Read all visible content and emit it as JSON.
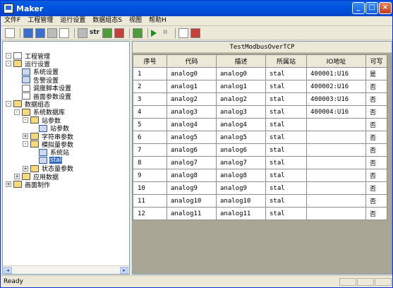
{
  "app": {
    "title": "Maker"
  },
  "menu": [
    "文件F",
    "工程管理",
    "运行设置",
    "数据组态S",
    "视图",
    "帮助H"
  ],
  "toolbar": {
    "str_label": "str"
  },
  "tree": [
    {
      "label": "工程管理",
      "level": 1,
      "expander": "-",
      "icon": "doc",
      "selected": false
    },
    {
      "label": "运行设置",
      "level": 1,
      "expander": "-",
      "icon": "folder",
      "selected": false
    },
    {
      "label": "系统设置",
      "level": 2,
      "expander": "",
      "icon": "win",
      "selected": false
    },
    {
      "label": "告警设置",
      "level": 2,
      "expander": "",
      "icon": "win",
      "selected": false
    },
    {
      "label": "调度脚本设置",
      "level": 2,
      "expander": "",
      "icon": "doc",
      "selected": false
    },
    {
      "label": "画面参数设置",
      "level": 2,
      "expander": "",
      "icon": "doc",
      "selected": false
    },
    {
      "label": "数据组态",
      "level": 1,
      "expander": "-",
      "icon": "folder",
      "selected": false
    },
    {
      "label": "系统数据库",
      "level": 2,
      "expander": "-",
      "icon": "folder",
      "selected": false
    },
    {
      "label": "站参数",
      "level": 3,
      "expander": "-",
      "icon": "folder",
      "selected": false
    },
    {
      "label": "站参数",
      "level": 4,
      "expander": "",
      "icon": "win",
      "selected": false
    },
    {
      "label": "字符串参数",
      "level": 3,
      "expander": "+",
      "icon": "folder",
      "selected": false
    },
    {
      "label": "模拟量参数",
      "level": 3,
      "expander": "-",
      "icon": "folder",
      "selected": false
    },
    {
      "label": "系统站",
      "level": 4,
      "expander": "",
      "icon": "win",
      "selected": false
    },
    {
      "label": "stal",
      "level": 4,
      "expander": "",
      "icon": "win",
      "selected": true
    },
    {
      "label": "状态量参数",
      "level": 3,
      "expander": "+",
      "icon": "folder",
      "selected": false
    },
    {
      "label": "应用数据",
      "level": 2,
      "expander": "+",
      "icon": "folder",
      "selected": false
    },
    {
      "label": "画面制作",
      "level": 1,
      "expander": "+",
      "icon": "folder",
      "selected": false
    }
  ],
  "document": {
    "title": "TestModbusOverTCP"
  },
  "table": {
    "columns": [
      "序号",
      "代码",
      "描述",
      "所属站",
      "IO地址",
      "可写"
    ],
    "rows": [
      [
        "1",
        "analog0",
        "analog0",
        "stal",
        "400001:U16",
        "是"
      ],
      [
        "2",
        "analog1",
        "analog1",
        "stal",
        "400002:U16",
        "否"
      ],
      [
        "3",
        "analog2",
        "analog2",
        "stal",
        "400003:U16",
        "否"
      ],
      [
        "4",
        "analog3",
        "analog3",
        "stal",
        "400004:U16",
        "否"
      ],
      [
        "5",
        "analog4",
        "analog4",
        "stal",
        "",
        "否"
      ],
      [
        "6",
        "analog5",
        "analog5",
        "stal",
        "",
        "否"
      ],
      [
        "7",
        "analog6",
        "analog6",
        "stal",
        "",
        "否"
      ],
      [
        "8",
        "analog7",
        "analog7",
        "stal",
        "",
        "否"
      ],
      [
        "9",
        "analog8",
        "analog8",
        "stal",
        "",
        "否"
      ],
      [
        "10",
        "analog9",
        "analog9",
        "stal",
        "",
        "否"
      ],
      [
        "11",
        "analog10",
        "analog10",
        "stal",
        "",
        "否"
      ],
      [
        "12",
        "analog11",
        "analog11",
        "stal",
        "",
        "否"
      ]
    ]
  },
  "status": {
    "text": "Ready"
  }
}
